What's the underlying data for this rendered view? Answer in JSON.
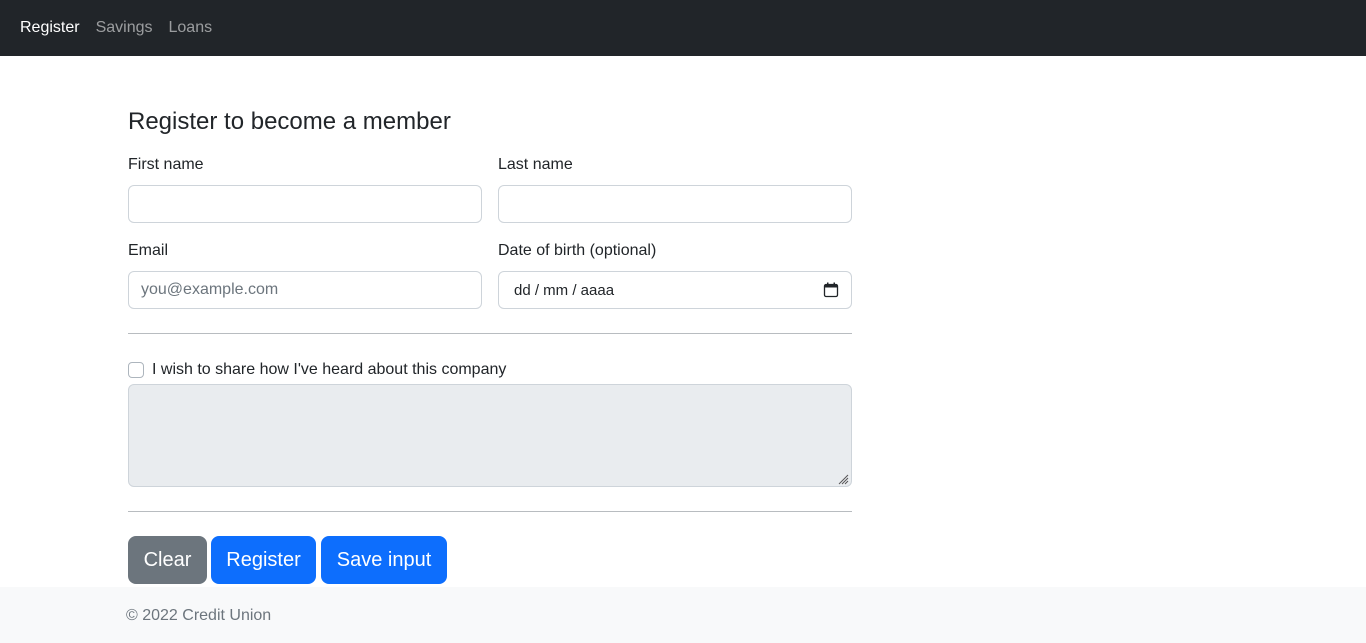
{
  "nav": {
    "items": [
      {
        "label": "Register",
        "active": true
      },
      {
        "label": "Savings",
        "active": false
      },
      {
        "label": "Loans",
        "active": false
      }
    ]
  },
  "form": {
    "heading": "Register to become a member",
    "first_name_label": "First name",
    "first_name_value": "",
    "last_name_label": "Last name",
    "last_name_value": "",
    "email_label": "Email",
    "email_placeholder": "you@example.com",
    "dob_label": "Date of birth (optional)",
    "dob_value": "dd / mm / aaaa",
    "dob_icon": "calendar-icon",
    "share_checkbox_label": "I wish to share how I've heard about this company",
    "share_checked": false,
    "share_textarea_disabled": true
  },
  "buttons": {
    "clear": "Clear",
    "register": "Register",
    "save": "Save input"
  },
  "footer": {
    "text": "© 2022 Credit Union"
  },
  "colors": {
    "navbar_bg": "#212529",
    "primary": "#0d6efd",
    "secondary": "#6c757d",
    "footer_bg": "#f8f9fa",
    "disabled_textarea": "#e9ecef"
  }
}
